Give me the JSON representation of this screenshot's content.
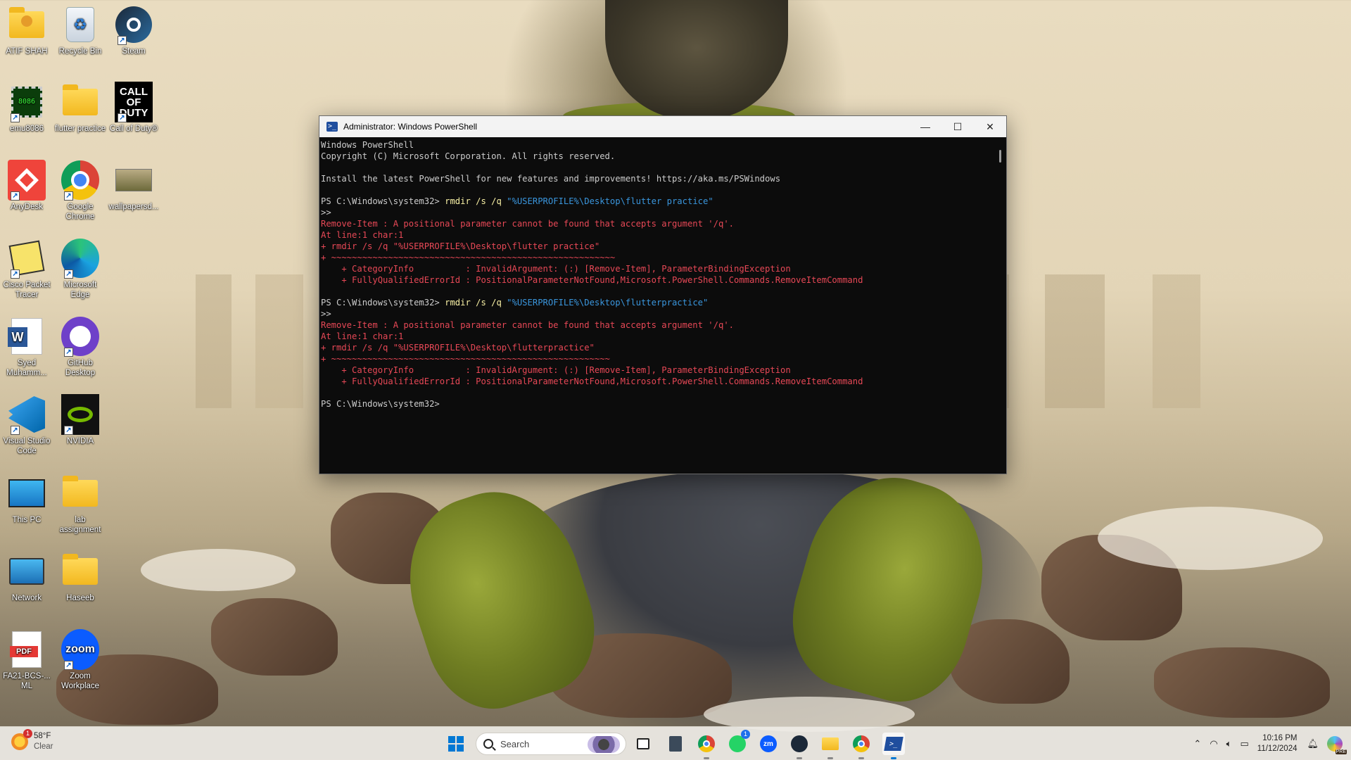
{
  "desktop": {
    "icons": [
      {
        "label": "ATIF SHAH",
        "icon": "user-folder-icon"
      },
      {
        "label": "Recycle Bin",
        "icon": "recycle-bin-icon"
      },
      {
        "label": "Steam",
        "icon": "steam-icon"
      },
      {
        "label": "emu8086",
        "icon": "chip-8086-icon",
        "glyph": "8086"
      },
      {
        "label": "flutter practice",
        "icon": "folder-icon"
      },
      {
        "label": "Call of Duty®",
        "icon": "call-of-duty-icon",
        "glyph": "CALL OF DUTY"
      },
      {
        "label": "AnyDesk",
        "icon": "anydesk-icon"
      },
      {
        "label": "Google Chrome",
        "icon": "chrome-icon"
      },
      {
        "label": "wallpapersd...",
        "icon": "image-file-icon"
      },
      {
        "label": "Cisco Packet Tracer",
        "icon": "packet-tracer-icon"
      },
      {
        "label": "Microsoft Edge",
        "icon": "edge-icon"
      },
      {
        "label": "Syed Muhamm...",
        "icon": "word-doc-icon",
        "glyph": "W"
      },
      {
        "label": "GitHub Desktop",
        "icon": "github-icon"
      },
      {
        "label": "Visual Studio Code",
        "icon": "vscode-icon"
      },
      {
        "label": "NVIDIA",
        "icon": "nvidia-icon"
      },
      {
        "label": "This PC",
        "icon": "monitor-icon"
      },
      {
        "label": "lab assignment",
        "icon": "folder-icon"
      },
      {
        "label": "Network",
        "icon": "network-icon"
      },
      {
        "label": "Haseeb",
        "icon": "folder-icon"
      },
      {
        "label": "FA21-BCS-... ML",
        "icon": "pdf-icon",
        "glyph": "PDF"
      },
      {
        "label": "Zoom Workplace",
        "icon": "zoom-icon",
        "glyph": "zoom"
      }
    ]
  },
  "window": {
    "title": "Administrator: Windows PowerShell",
    "app_glyph": ">_",
    "minimize": "—",
    "maximize": "☐",
    "close": "✕",
    "lines": [
      {
        "text": "Windows PowerShell",
        "parts": [
          {
            "t": "Windows PowerShell",
            "c": "out"
          }
        ]
      },
      {
        "parts": [
          {
            "t": "Copyright (C) Microsoft Corporation. All rights reserved.",
            "c": "out"
          }
        ]
      },
      {
        "parts": [
          {
            "t": "",
            "c": "out"
          }
        ]
      },
      {
        "parts": [
          {
            "t": "Install the latest PowerShell for new features and improvements! https://aka.ms/PSWindows",
            "c": "out"
          }
        ]
      },
      {
        "parts": [
          {
            "t": "",
            "c": "out"
          }
        ]
      },
      {
        "parts": [
          {
            "t": "PS C:\\Windows\\system32> ",
            "c": "out"
          },
          {
            "t": "rmdir /s /q ",
            "c": "cmd"
          },
          {
            "t": "\"%USERPROFILE%\\Desktop\\flutter practice\"",
            "c": "str"
          }
        ]
      },
      {
        "parts": [
          {
            "t": ">>",
            "c": "out"
          }
        ]
      },
      {
        "parts": [
          {
            "t": "Remove-Item : A positional parameter cannot be found that accepts argument '/q'.",
            "c": "err"
          }
        ]
      },
      {
        "parts": [
          {
            "t": "At line:1 char:1",
            "c": "err"
          }
        ]
      },
      {
        "parts": [
          {
            "t": "+ rmdir /s /q \"%USERPROFILE%\\Desktop\\flutter practice\"",
            "c": "err"
          }
        ]
      },
      {
        "parts": [
          {
            "t": "+ ~~~~~~~~~~~~~~~~~~~~~~~~~~~~~~~~~~~~~~~~~~~~~~~~~~~~~~~",
            "c": "err"
          }
        ]
      },
      {
        "parts": [
          {
            "t": "    + CategoryInfo          : InvalidArgument: (:) [Remove-Item], ParameterBindingException",
            "c": "err"
          }
        ]
      },
      {
        "parts": [
          {
            "t": "    + FullyQualifiedErrorId : PositionalParameterNotFound,Microsoft.PowerShell.Commands.RemoveItemCommand",
            "c": "err"
          }
        ]
      },
      {
        "parts": [
          {
            "t": "",
            "c": "out"
          }
        ]
      },
      {
        "parts": [
          {
            "t": "PS C:\\Windows\\system32> ",
            "c": "out"
          },
          {
            "t": "rmdir /s /q ",
            "c": "cmd"
          },
          {
            "t": "\"%USERPROFILE%\\Desktop\\flutterpractice\"",
            "c": "str"
          }
        ]
      },
      {
        "parts": [
          {
            "t": ">>",
            "c": "out"
          }
        ]
      },
      {
        "parts": [
          {
            "t": "Remove-Item : A positional parameter cannot be found that accepts argument '/q'.",
            "c": "err"
          }
        ]
      },
      {
        "parts": [
          {
            "t": "At line:1 char:1",
            "c": "err"
          }
        ]
      },
      {
        "parts": [
          {
            "t": "+ rmdir /s /q \"%USERPROFILE%\\Desktop\\flutterpractice\"",
            "c": "err"
          }
        ]
      },
      {
        "parts": [
          {
            "t": "+ ~~~~~~~~~~~~~~~~~~~~~~~~~~~~~~~~~~~~~~~~~~~~~~~~~~~~~~",
            "c": "err"
          }
        ]
      },
      {
        "parts": [
          {
            "t": "    + CategoryInfo          : InvalidArgument: (:) [Remove-Item], ParameterBindingException",
            "c": "err"
          }
        ]
      },
      {
        "parts": [
          {
            "t": "    + FullyQualifiedErrorId : PositionalParameterNotFound,Microsoft.PowerShell.Commands.RemoveItemCommand",
            "c": "err"
          }
        ]
      },
      {
        "parts": [
          {
            "t": "",
            "c": "out"
          }
        ]
      },
      {
        "parts": [
          {
            "t": "PS C:\\Windows\\system32>",
            "c": "out"
          }
        ]
      }
    ]
  },
  "taskbar": {
    "weather": {
      "temp": "58°F",
      "condition": "Clear",
      "badge": "1"
    },
    "search_placeholder": "Search",
    "apps": [
      {
        "name": "start-button",
        "icon": "windows-start-icon"
      },
      {
        "name": "task-view-button",
        "icon": "task-view-icon"
      },
      {
        "name": "calculator-button",
        "icon": "calculator-icon"
      },
      {
        "name": "chrome-button",
        "icon": "chrome-icon"
      },
      {
        "name": "whatsapp-button",
        "icon": "whatsapp-icon",
        "badge": "1"
      },
      {
        "name": "zoom-button",
        "icon": "zoom-icon",
        "glyph": "zm"
      },
      {
        "name": "steam-button",
        "icon": "steam-icon"
      },
      {
        "name": "file-explorer-button",
        "icon": "folder-icon"
      },
      {
        "name": "chrome-profile-button",
        "icon": "chrome-icon"
      },
      {
        "name": "powershell-button",
        "icon": "powershell-icon",
        "glyph": ">_"
      }
    ],
    "clock": {
      "time": "10:16 PM",
      "date": "11/12/2024"
    },
    "tray_icons": [
      "chevron-up-icon",
      "wifi-icon",
      "volume-icon",
      "battery-icon",
      "bell-icon",
      "copilot-icon"
    ],
    "copilot_badge": "PRE"
  },
  "colors": {
    "console_bg": "#0c0c0c",
    "console_text": "#cccccc",
    "cmd_yellow": "#f9f1a5",
    "str_blue": "#3a96dd",
    "err_red": "#e74856"
  }
}
